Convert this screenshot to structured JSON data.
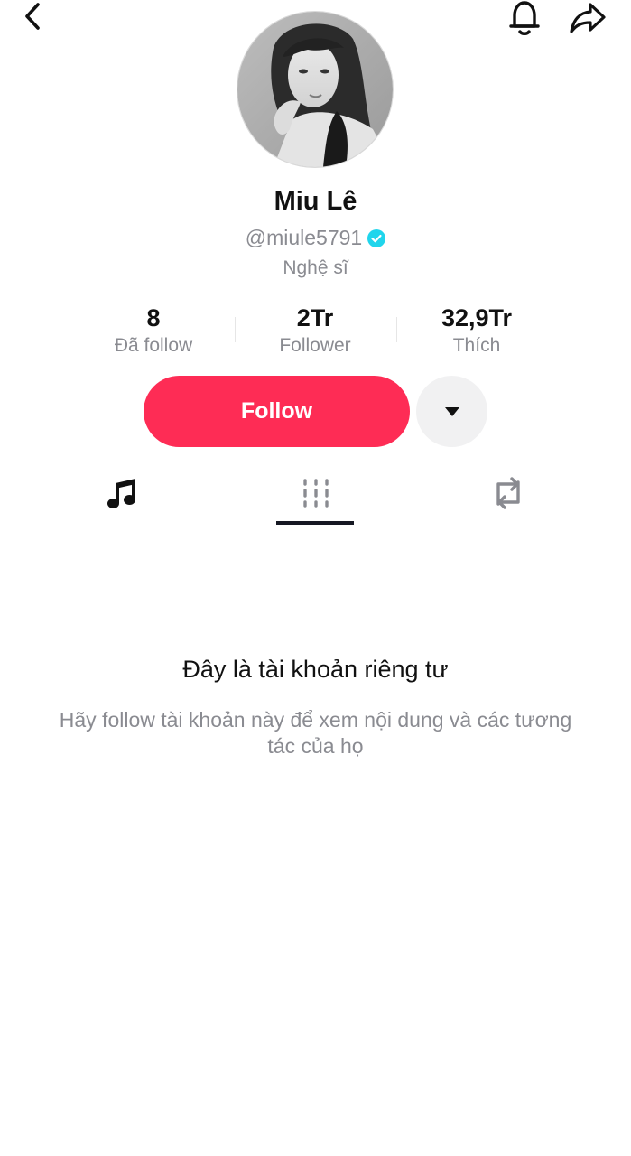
{
  "header": {
    "back_icon": "chevron-left-icon",
    "bell_icon": "bell-icon",
    "share_icon": "share-arrow-icon"
  },
  "profile": {
    "name": "Miu Lê",
    "handle": "@miule5791",
    "verified": true,
    "verified_color": "#20d5ec",
    "role": "Nghệ sĩ"
  },
  "stats": [
    {
      "value": "8",
      "label": "Đã follow"
    },
    {
      "value": "2Tr",
      "label": "Follower"
    },
    {
      "value": "32,9Tr",
      "label": "Thích"
    }
  ],
  "actions": {
    "follow_label": "Follow",
    "follow_color": "#fe2c55",
    "more_icon": "caret-down-icon"
  },
  "tabs": [
    {
      "icon": "music-note-icon",
      "selected": false
    },
    {
      "icon": "video-grid-icon",
      "selected": true
    },
    {
      "icon": "repost-icon",
      "selected": false
    }
  ],
  "private_notice": {
    "title": "Đây là tài khoản riêng tư",
    "description": "Hãy follow tài khoản này để xem nội dung và các tương tác của họ"
  }
}
